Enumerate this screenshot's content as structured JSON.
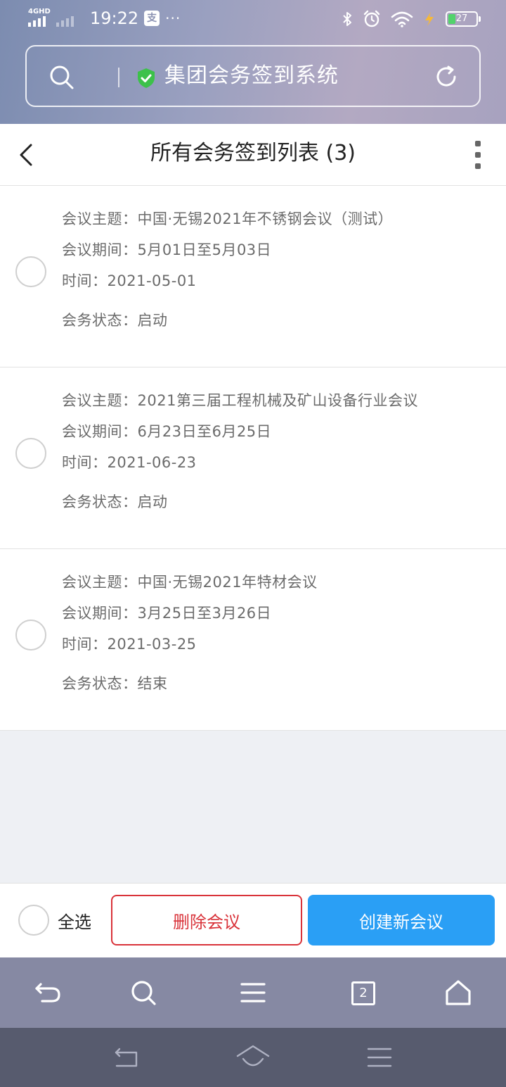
{
  "status_bar": {
    "network": "4GHD",
    "time": "19:22",
    "alipay_badge": "支",
    "more": "···",
    "battery": "27",
    "battery_percent": 27
  },
  "address_bar": {
    "site_title": "集团会务签到系统"
  },
  "header": {
    "title": "所有会务签到列表 (3)"
  },
  "meetings": [
    {
      "topic": "会议主题：中国·无锡2021年不锈钢会议（测试）",
      "period": "会议期间：5月01日至5月03日",
      "time": "时间：2021-05-01",
      "status": "会务状态：启动"
    },
    {
      "topic": "会议主题：2021第三届工程机械及矿山设备行业会议",
      "period": "会议期间：6月23日至6月25日",
      "time": "时间：2021-06-23",
      "status": "会务状态：启动"
    },
    {
      "topic": "会议主题：中国·无锡2021年特材会议",
      "period": "会议期间：3月25日至3月26日",
      "time": "时间：2021-03-25",
      "status": "会务状态：结束"
    }
  ],
  "actions": {
    "select_all_label": "全选",
    "delete_label": "删除会议",
    "create_label": "创建新会议"
  },
  "browser_toolbar": {
    "tab_count": "2"
  },
  "colors": {
    "danger": "#d9333a",
    "primary": "#2a9ff5",
    "secure": "#3cc14a"
  }
}
